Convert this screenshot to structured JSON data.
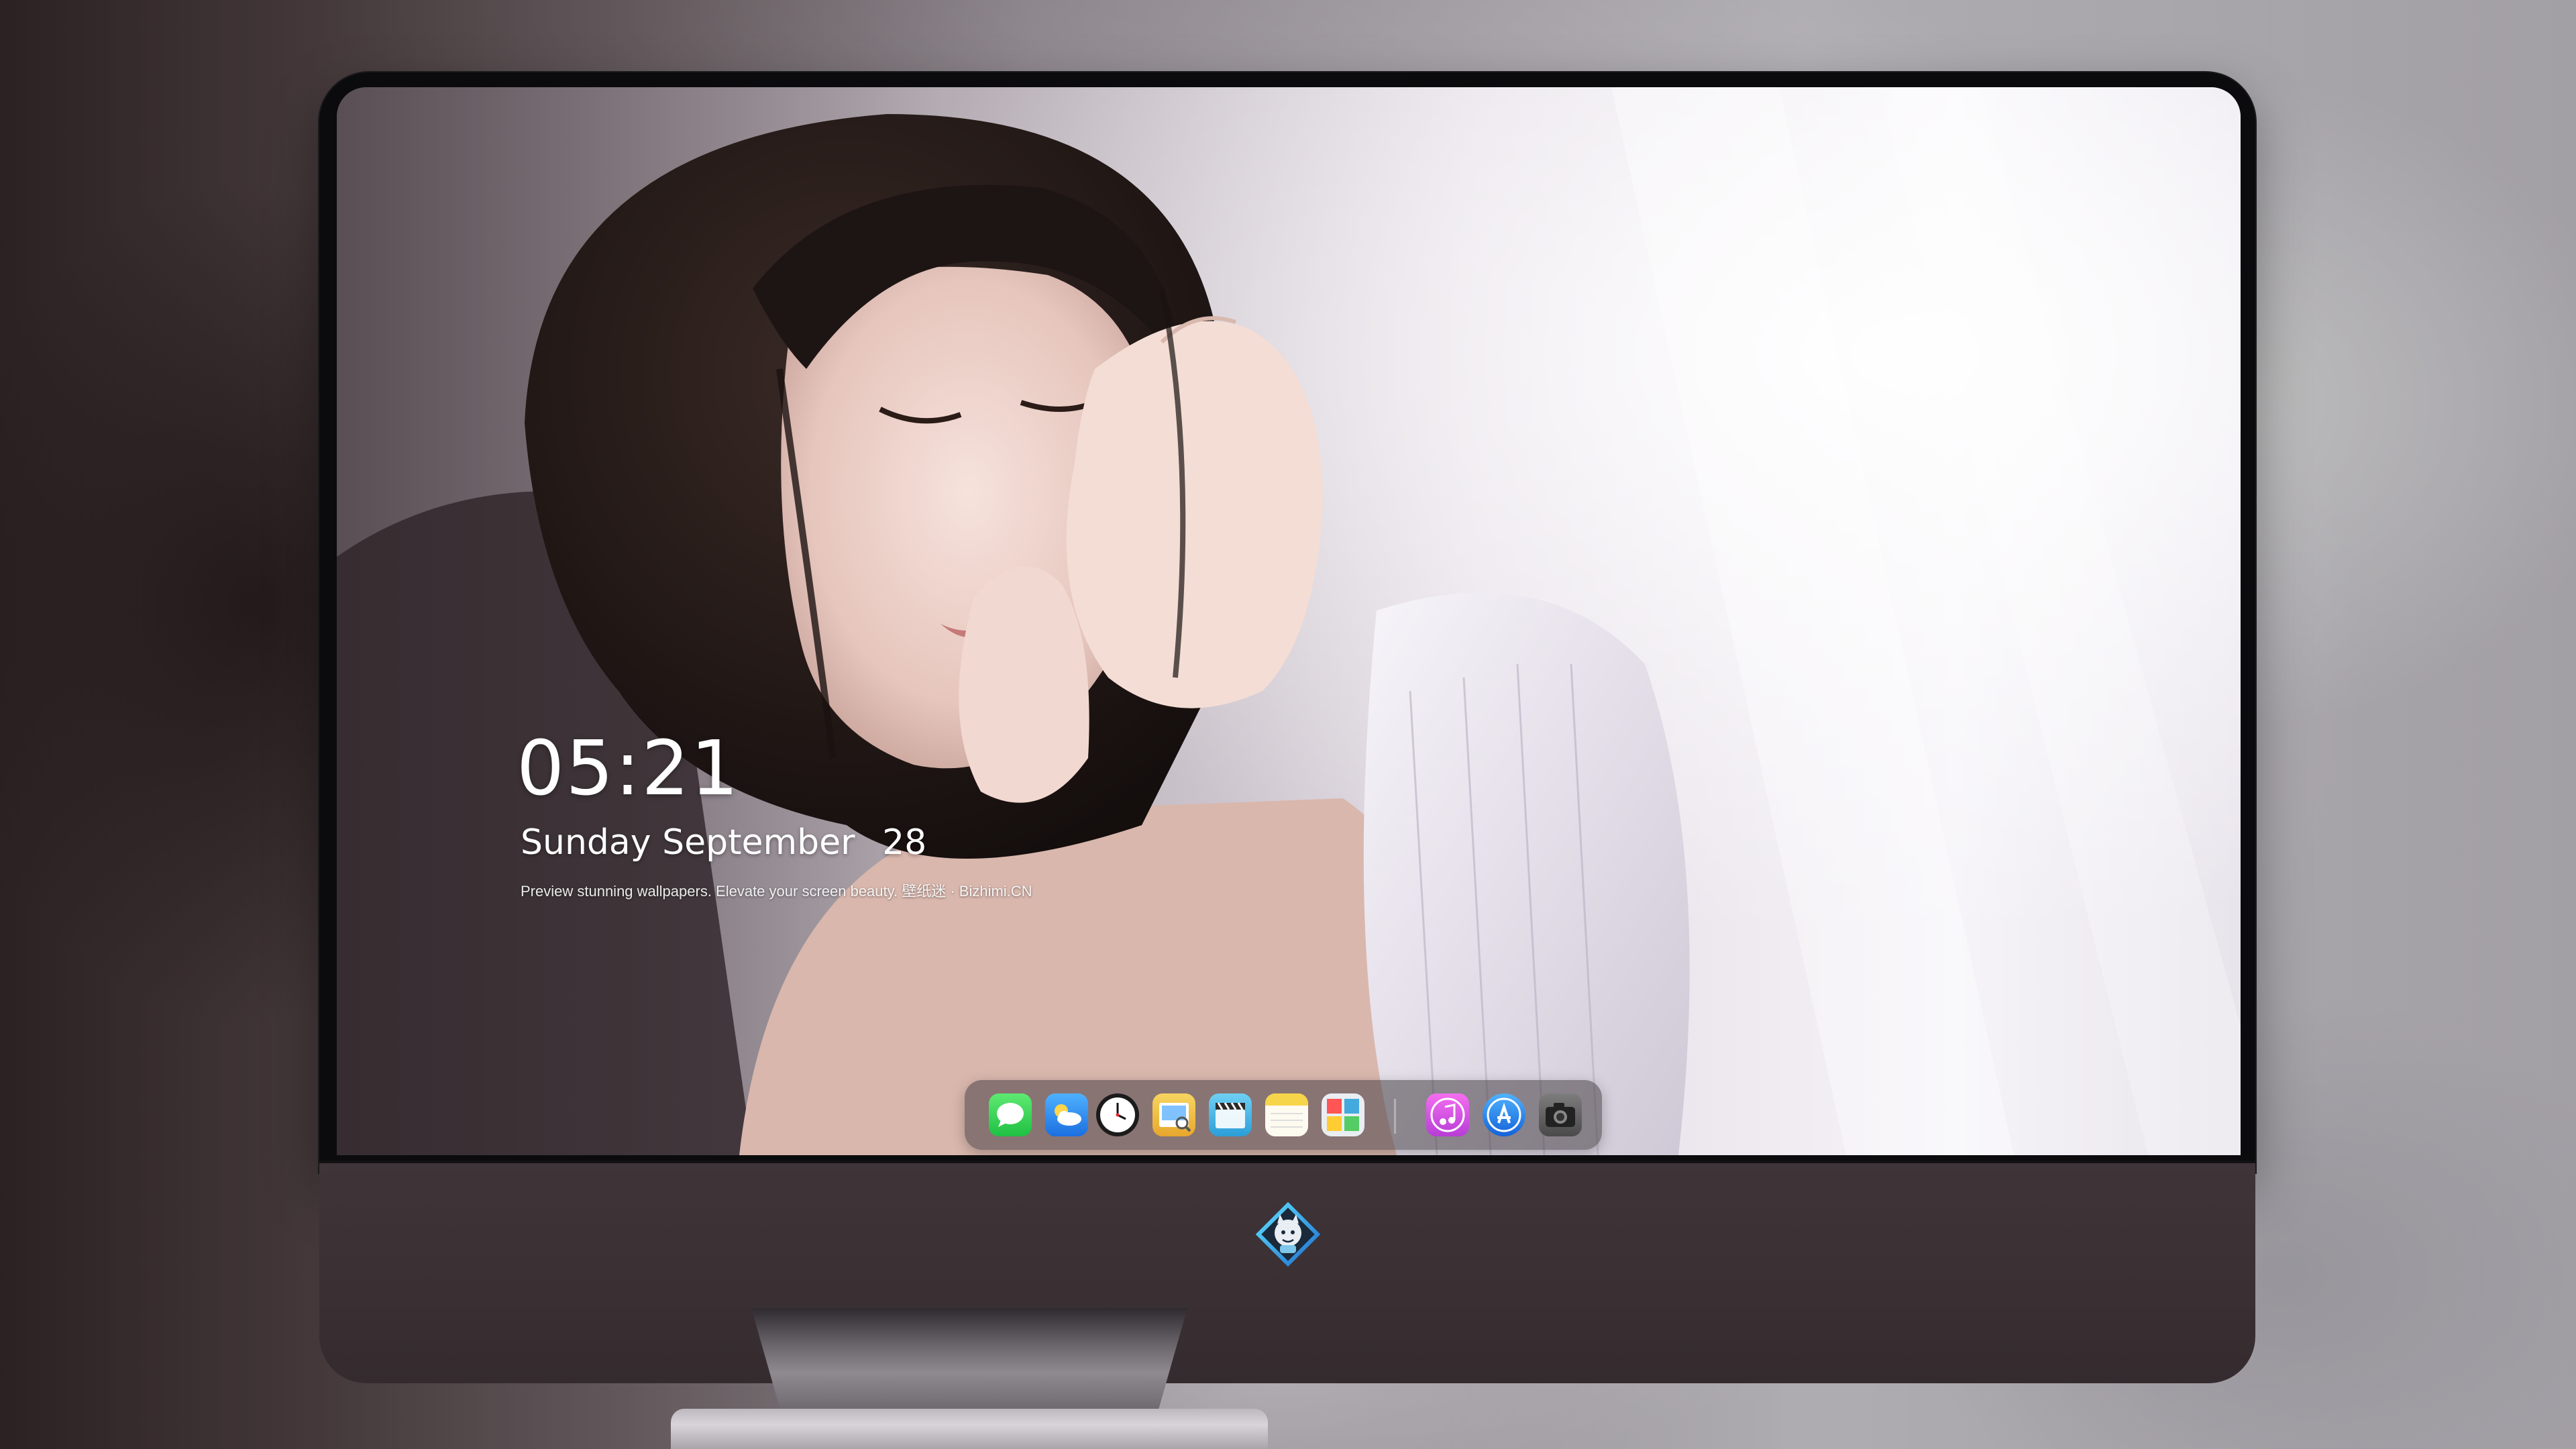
{
  "lockscreen": {
    "time": "05:21",
    "weekday": "Sunday",
    "month": "September",
    "day": "28",
    "caption": "Preview stunning wallpapers. Elevate your screen beauty. 壁纸迷 · Bizhimi.CN"
  },
  "dock": {
    "apps": [
      {
        "name": "Messages",
        "icon": "messages-icon",
        "color": "#3ad35a"
      },
      {
        "name": "Weather",
        "icon": "weather-icon",
        "color": "#2f8ff5"
      },
      {
        "name": "Clock",
        "icon": "clock-icon",
        "color": "#1b1b1b"
      },
      {
        "name": "Preview",
        "icon": "preview-icon",
        "color": "#f2c94c"
      },
      {
        "name": "Clips",
        "icon": "clapperboard-icon",
        "color": "#3fb3e8"
      },
      {
        "name": "Notes",
        "icon": "notes-icon",
        "color": "#f7d54a"
      },
      {
        "name": "Photo Booth",
        "icon": "photo-gallery-icon",
        "color": "#e6e6e6"
      },
      {
        "name": "iTunes",
        "icon": "music-note-icon",
        "color": "#d84bd8"
      },
      {
        "name": "App Store",
        "icon": "app-store-icon",
        "color": "#1f8ef1"
      },
      {
        "name": "Camera",
        "icon": "camera-icon",
        "color": "#6a6a6a"
      }
    ]
  },
  "colors": {
    "bezel": "#0b0b0d",
    "chin": "#3a3034",
    "dock_background": "rgba(70,62,68,0.55)"
  }
}
